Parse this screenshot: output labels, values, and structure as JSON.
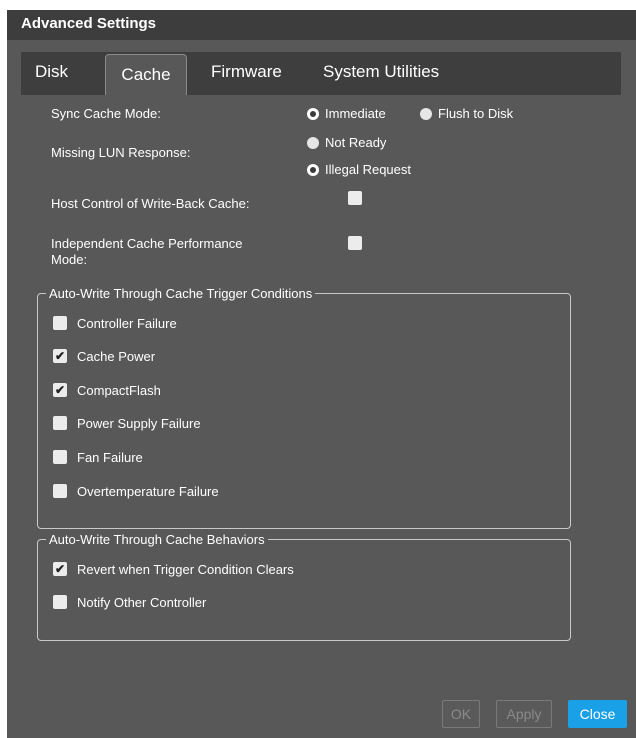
{
  "dialog": {
    "title": "Advanced Settings"
  },
  "tabs": [
    {
      "label": "Disk",
      "active": false
    },
    {
      "label": "Cache",
      "active": true
    },
    {
      "label": "Firmware",
      "active": false
    },
    {
      "label": "System Utilities",
      "active": false
    }
  ],
  "settings": {
    "sync_cache_mode": {
      "label": "Sync Cache Mode:",
      "options": [
        {
          "label": "Immediate",
          "selected": true
        },
        {
          "label": "Flush to Disk",
          "selected": false
        }
      ]
    },
    "missing_lun_response": {
      "label": "Missing LUN Response:",
      "options": [
        {
          "label": "Not Ready",
          "selected": false
        },
        {
          "label": "Illegal Request",
          "selected": true
        }
      ]
    },
    "host_control_write_back": {
      "label": "Host Control of Write-Back Cache:",
      "checked": false
    },
    "independent_cache_perf": {
      "label_line1": "Independent Cache Performance",
      "label_line2": "Mode:",
      "checked": false
    }
  },
  "trigger_conditions": {
    "legend": "Auto-Write Through Cache Trigger Conditions",
    "items": [
      {
        "label": "Controller Failure",
        "checked": false
      },
      {
        "label": "Cache Power",
        "checked": true
      },
      {
        "label": "CompactFlash",
        "checked": true
      },
      {
        "label": "Power Supply Failure",
        "checked": false
      },
      {
        "label": "Fan Failure",
        "checked": false
      },
      {
        "label": "Overtemperature Failure",
        "checked": false
      }
    ]
  },
  "behaviors": {
    "legend": "Auto-Write Through Cache Behaviors",
    "items": [
      {
        "label": "Revert when Trigger Condition Clears",
        "checked": true
      },
      {
        "label": "Notify Other Controller",
        "checked": false
      }
    ]
  },
  "footer": {
    "ok_label": "OK",
    "apply_label": "Apply",
    "close_label": "Close"
  },
  "colors": {
    "panel": "#585858",
    "titlebar": "#3d3d3d",
    "tabbar": "#3e3e3e",
    "accent": "#1aa0e6"
  }
}
